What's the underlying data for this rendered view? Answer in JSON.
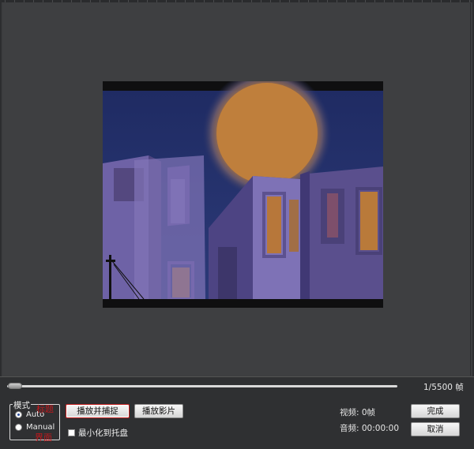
{
  "player": {
    "frame_counter": "1/5500 帧"
  },
  "mode": {
    "legend": "模式",
    "options": [
      "Auto",
      "Manual"
    ],
    "selected": "Auto",
    "annotation_top": "标题",
    "annotation_bottom": "界面"
  },
  "buttons": {
    "play_capture": "播放并捕捉",
    "play_movie": "播放影片",
    "done": "完成",
    "cancel": "取消"
  },
  "minimize_to_tray": {
    "label": "最小化到托盘",
    "checked": false
  },
  "stats": {
    "video": "视频: 0帧",
    "audio": "音频: 00:00:00"
  },
  "playback": {
    "position_fraction": 0.0
  }
}
